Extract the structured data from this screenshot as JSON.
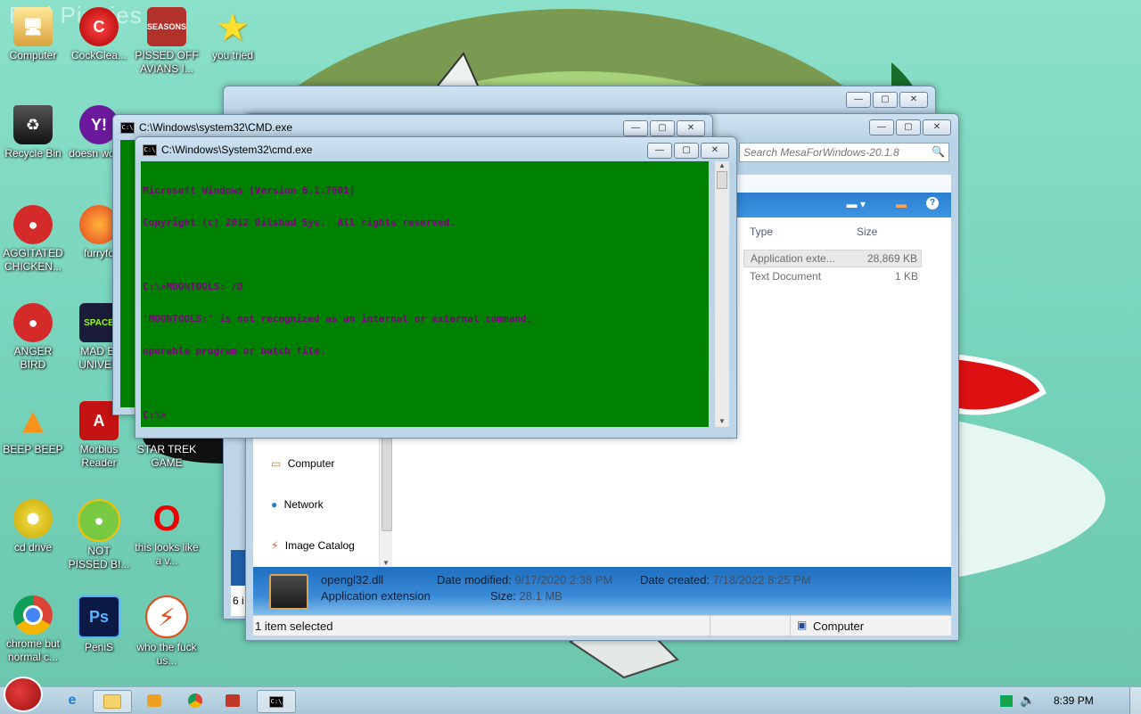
{
  "wallpaper": {
    "watermark": "Bad Piggies"
  },
  "desktop_icons": [
    {
      "label": "Computer"
    },
    {
      "label": "CockClea..."
    },
    {
      "label": "PISSED OFF AVIANS I..."
    },
    {
      "label": "you tried"
    },
    {
      "label": "Recycle Bin"
    },
    {
      "label": "doesn work l"
    },
    {
      "label": "AGGITATED CHICKEN..."
    },
    {
      "label": "furryfo"
    },
    {
      "label": "ANGER BIRD"
    },
    {
      "label": "MAD BI UNIVER"
    },
    {
      "label": "BEEP BEEP"
    },
    {
      "label": "Morbius Reader"
    },
    {
      "label": "STAR TREK GAME"
    },
    {
      "label": "cd drive"
    },
    {
      "label": "NOT PISSED BI..."
    },
    {
      "label": "this looks like a v..."
    },
    {
      "label": "chrome but normal c..."
    },
    {
      "label": "PeniS"
    },
    {
      "label": "who the fuck us..."
    }
  ],
  "explorer": {
    "search_placeholder": "Search MesaForWindows-20.1.8",
    "columns": [
      "Type",
      "Size"
    ],
    "rows": [
      {
        "type": "Application exte...",
        "size": "28,869 KB"
      },
      {
        "type": "Text Document",
        "size": "1 KB"
      }
    ],
    "nav_items": [
      "Computer",
      "Network",
      "Image Catalog"
    ],
    "details": {
      "filename": "opengl32.dll",
      "filetype": "Application extension",
      "modified_label": "Date modified:",
      "modified_value": "9/17/2020 2:38 PM",
      "created_label": "Date created:",
      "created_value": "7/18/2022 8:25 PM",
      "size_label": "Size:",
      "size_value": "28.1 MB"
    },
    "status_left": "1 item selected",
    "status_right": "Computer",
    "back_count": "6 i"
  },
  "cmd_back": {
    "title": "C:\\Windows\\system32\\CMD.exe"
  },
  "cmd_front": {
    "title": "C:\\Windows\\System32\\cmd.exe",
    "lines": [
      "Microsoft Windows [Version 6.1.7601]",
      "Copyright (c) 2012 Dilshad Sys.  All rights reserved.",
      "",
      "C:\\>MOONTOOLS: /D",
      "'MOONTOOLS:' is not recognized as an internal or external command,",
      "operable program or batch file.",
      "",
      "C:\\>"
    ]
  },
  "taskbar": {
    "clock": "8:39 PM"
  },
  "colors": {
    "console_bg": "#008000",
    "console_fg": "#800080",
    "details_bar": "#1e6fc0"
  }
}
